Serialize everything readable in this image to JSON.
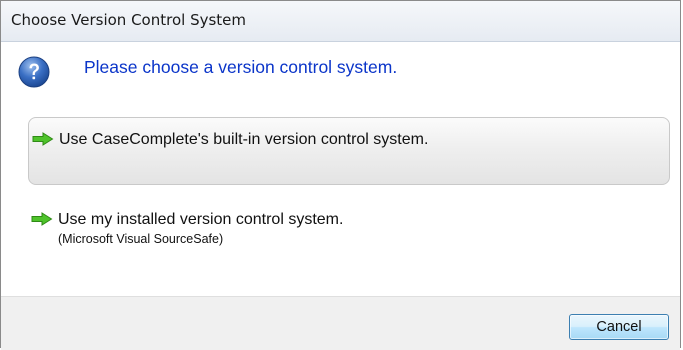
{
  "window": {
    "title": "Choose Version Control System"
  },
  "main": {
    "heading": "Please choose a version control system.",
    "icon": "question-icon",
    "options": [
      {
        "label": "Use CaseComplete's built-in version control system.",
        "icon": "green-arrow-icon",
        "selected": true
      },
      {
        "label": "Use my installed version control system.",
        "sublabel": "(Microsoft Visual SourceSafe)",
        "icon": "green-arrow-icon",
        "selected": false
      }
    ]
  },
  "footer": {
    "cancel_label": "Cancel"
  },
  "colors": {
    "heading": "#0b35c9",
    "icon_blue": "#2e63b8",
    "arrow_green": "#4ec32a",
    "button_border": "#3c7fb1",
    "footer_bg": "#f0f0f0"
  }
}
